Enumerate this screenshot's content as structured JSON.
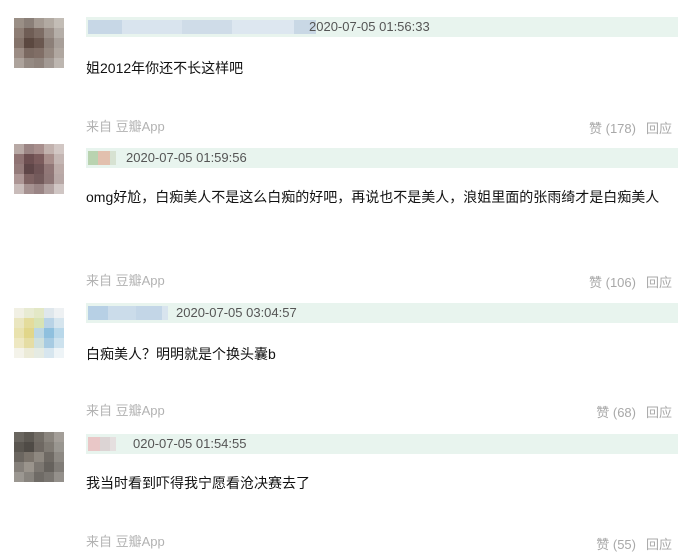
{
  "comments": [
    {
      "timestamp": "2020-07-05 01:56:33",
      "text": "姐2012年你还不长这样吧",
      "source": "来自 豆瓣App",
      "like_label": "赞 (178)",
      "reply_label": "回应"
    },
    {
      "timestamp": "2020-07-05 01:59:56",
      "text": "omg好尬，白痴美人不是这么白痴的好吧，再说也不是美人，浪姐里面的张雨绮才是白痴美人",
      "source": "来自 豆瓣App",
      "like_label": "赞 (106)",
      "reply_label": "回应"
    },
    {
      "timestamp": "2020-07-05 03:04:57",
      "text": "白痴美人？明明就是个换头囊b",
      "source": "来自 豆瓣App",
      "like_label": "赞 (68)",
      "reply_label": "回应"
    },
    {
      "timestamp": "020-07-05 01:54:55",
      "text": "我当时看到吓得我宁愿看沧决赛去了",
      "source": "来自 豆瓣App",
      "like_label": "赞 (55)",
      "reply_label": "回应"
    }
  ]
}
